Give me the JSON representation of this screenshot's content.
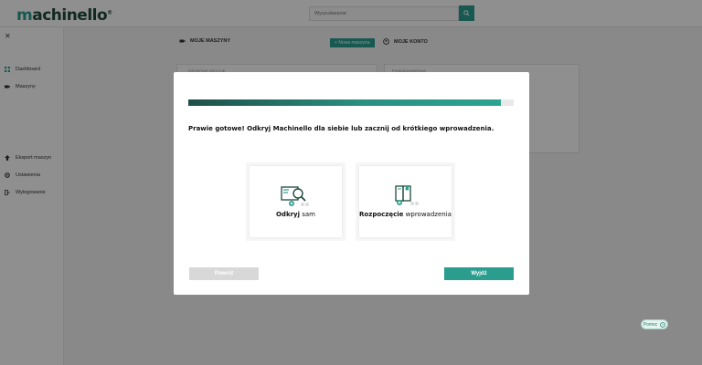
{
  "header": {
    "logo_prefix": "m",
    "logo_main": "achinello",
    "search": {
      "placeholder": "Wyszukiwanie"
    }
  },
  "sidebar": {
    "items": [
      {
        "label": "Dashboard"
      },
      {
        "label": "Maszyny"
      },
      {
        "label": "Eksport maszyn"
      },
      {
        "label": "Ustawienia"
      },
      {
        "label": "Wylogowanie"
      }
    ]
  },
  "main": {
    "tabs": [
      {
        "label": "MOJE MASZYNY"
      },
      {
        "label": "MOJE KONTO"
      }
    ],
    "new_machine_label": "Nowa maszyna",
    "cards": [
      {
        "title": "OSTATNIE EDYCJE"
      },
      {
        "title": "POWIADOMIENIA"
      }
    ]
  },
  "help": {
    "label": "Pomoc"
  },
  "onboarding_modal": {
    "progress_percent": 96,
    "heading": "Prawie gotowe! Odkryj Machinello dla siebie lub zacznij od krótkiego wprowadzenia.",
    "options": [
      {
        "bold": "Odkryj",
        "rest": " sam",
        "icon": "discover-icon"
      },
      {
        "bold": "Rozpoczęcie",
        "rest": " wprowadzenia",
        "icon": "tutorial-book-icon"
      }
    ],
    "back_label": "Powrót",
    "exit_label": "Wyjdź"
  },
  "colors": {
    "accent": "#2a9d8f",
    "brand_dark": "#1f4a3c"
  }
}
